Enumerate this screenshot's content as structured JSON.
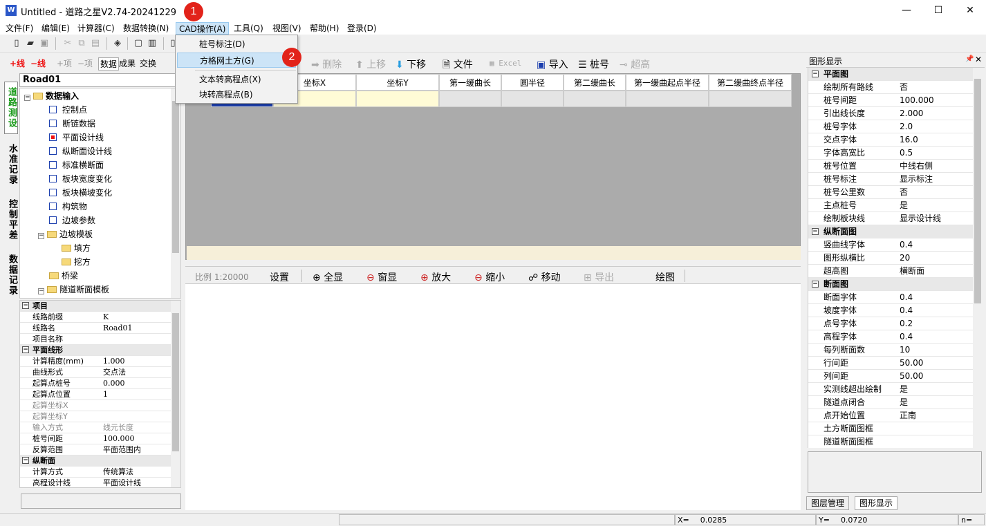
{
  "window": {
    "title": "Untitled - 道路之星V2.74-20241229",
    "minimize": "—",
    "maximize": "☐",
    "close": "✕"
  },
  "menubar": [
    "文件(F)",
    "编辑(E)",
    "计算器(C)",
    "数据转换(N)",
    "CAD操作(A)",
    "工具(Q)",
    "视图(V)",
    "帮助(H)",
    "登录(D)"
  ],
  "dropdown": {
    "items": [
      "桩号标注(D)",
      "方格网土方(G)",
      "文本转高程点(X)",
      "块转高程点(B)"
    ]
  },
  "badges": [
    "1",
    "2"
  ],
  "left_toolbar": {
    "add_line": "+线",
    "del_line": "−线",
    "add_item": "+项",
    "del_item": "−项",
    "data": "数据",
    "result": "成果",
    "exchange": "交换"
  },
  "vertical_tabs": [
    "道路测设",
    "水准记录",
    "控制平差",
    "数据记录"
  ],
  "road_name": "Road01",
  "tree": {
    "root": "数据输入",
    "items": [
      "控制点",
      "断链数据",
      "平面设计线",
      "纵断面设计线",
      "标准横断面",
      "板块宽度变化",
      "板块横坡变化",
      "构筑物",
      "边坡参数"
    ],
    "slope_template": "边坡模板",
    "slope_children": [
      "填方",
      "挖方"
    ],
    "bridge": "桥梁",
    "tunnel_template": "隧道断面模板"
  },
  "props": [
    {
      "group": "项目"
    },
    {
      "k": "线路前缀",
      "v": "K"
    },
    {
      "k": "线路名",
      "v": "Road01"
    },
    {
      "k": "项目名称",
      "v": ""
    },
    {
      "group": "平面线形"
    },
    {
      "k": "计算精度(mm)",
      "v": "1.000"
    },
    {
      "k": "曲线形式",
      "v": "交点法"
    },
    {
      "k": "起算点桩号",
      "v": "0.000"
    },
    {
      "k": "起算点位置",
      "v": "1"
    },
    {
      "k": "起算坐标X",
      "v": "",
      "dis": true
    },
    {
      "k": "起算坐标Y",
      "v": "",
      "dis": true
    },
    {
      "k": "输入方式",
      "v": "线元长度",
      "dis": true
    },
    {
      "k": "桩号间距",
      "v": "100.000"
    },
    {
      "k": "反算范围",
      "v": "平面范围内"
    },
    {
      "group": "纵断面"
    },
    {
      "k": "计算方式",
      "v": "传统算法"
    },
    {
      "k": "高程设计线",
      "v": "平面设计线"
    }
  ],
  "main_toolbar": {
    "delete": "删除",
    "up": "上移",
    "down": "下移",
    "file": "文件",
    "excel": "Excel",
    "import": "导入",
    "stake": "桩号",
    "elevation": "超高"
  },
  "grid_headers": [
    "坐标X",
    "坐标Y",
    "第一缓曲长",
    "圆半径",
    "第二缓曲长",
    "第一缓曲起点半径",
    "第二缓曲终点半径"
  ],
  "draw_toolbar": {
    "scale": "比例 1:20000",
    "settings": "设置",
    "fit": "全显",
    "window": "窗显",
    "zoom_in": "放大",
    "zoom_out": "缩小",
    "pan": "移动",
    "export": "导出",
    "draw": "绘图"
  },
  "right_panel": {
    "title": "图形显示",
    "rows": [
      {
        "group": "平面图"
      },
      {
        "k": "绘制所有路线",
        "v": "否"
      },
      {
        "k": "桩号间距",
        "v": "100.000"
      },
      {
        "k": "引出线长度",
        "v": "2.000"
      },
      {
        "k": "桩号字体",
        "v": "2.0"
      },
      {
        "k": "交点字体",
        "v": "16.0"
      },
      {
        "k": "字体高宽比",
        "v": "0.5"
      },
      {
        "k": "桩号位置",
        "v": "中线右侧"
      },
      {
        "k": "桩号标注",
        "v": "显示标注"
      },
      {
        "k": "桩号公里数",
        "v": "否"
      },
      {
        "k": "主点桩号",
        "v": "是"
      },
      {
        "k": "绘制板块线",
        "v": "显示设计线"
      },
      {
        "group": "纵断面图"
      },
      {
        "k": "竖曲线字体",
        "v": "0.4"
      },
      {
        "k": "图形纵横比",
        "v": "20"
      },
      {
        "k": "超高图",
        "v": "横断面"
      },
      {
        "group": "断面图"
      },
      {
        "k": "断面字体",
        "v": "0.4"
      },
      {
        "k": "坡度字体",
        "v": "0.4"
      },
      {
        "k": "点号字体",
        "v": "0.2"
      },
      {
        "k": "高程字体",
        "v": "0.4"
      },
      {
        "k": "每列断面数",
        "v": "10"
      },
      {
        "k": "行间距",
        "v": "50.00"
      },
      {
        "k": "列间距",
        "v": "50.00"
      },
      {
        "k": "实测线超出绘制",
        "v": "是"
      },
      {
        "k": "隧道点闭合",
        "v": "是"
      },
      {
        "k": "点开始位置",
        "v": "正南"
      },
      {
        "k": "土方断面图框",
        "v": ""
      },
      {
        "k": "隧道断面图框",
        "v": ""
      }
    ],
    "tabs": [
      "图层管理",
      "图形显示"
    ]
  },
  "status": {
    "x_label": "X=",
    "x_value": "0.0285",
    "y_label": "Y=",
    "y_value": "0.0720",
    "n_label": "n="
  }
}
